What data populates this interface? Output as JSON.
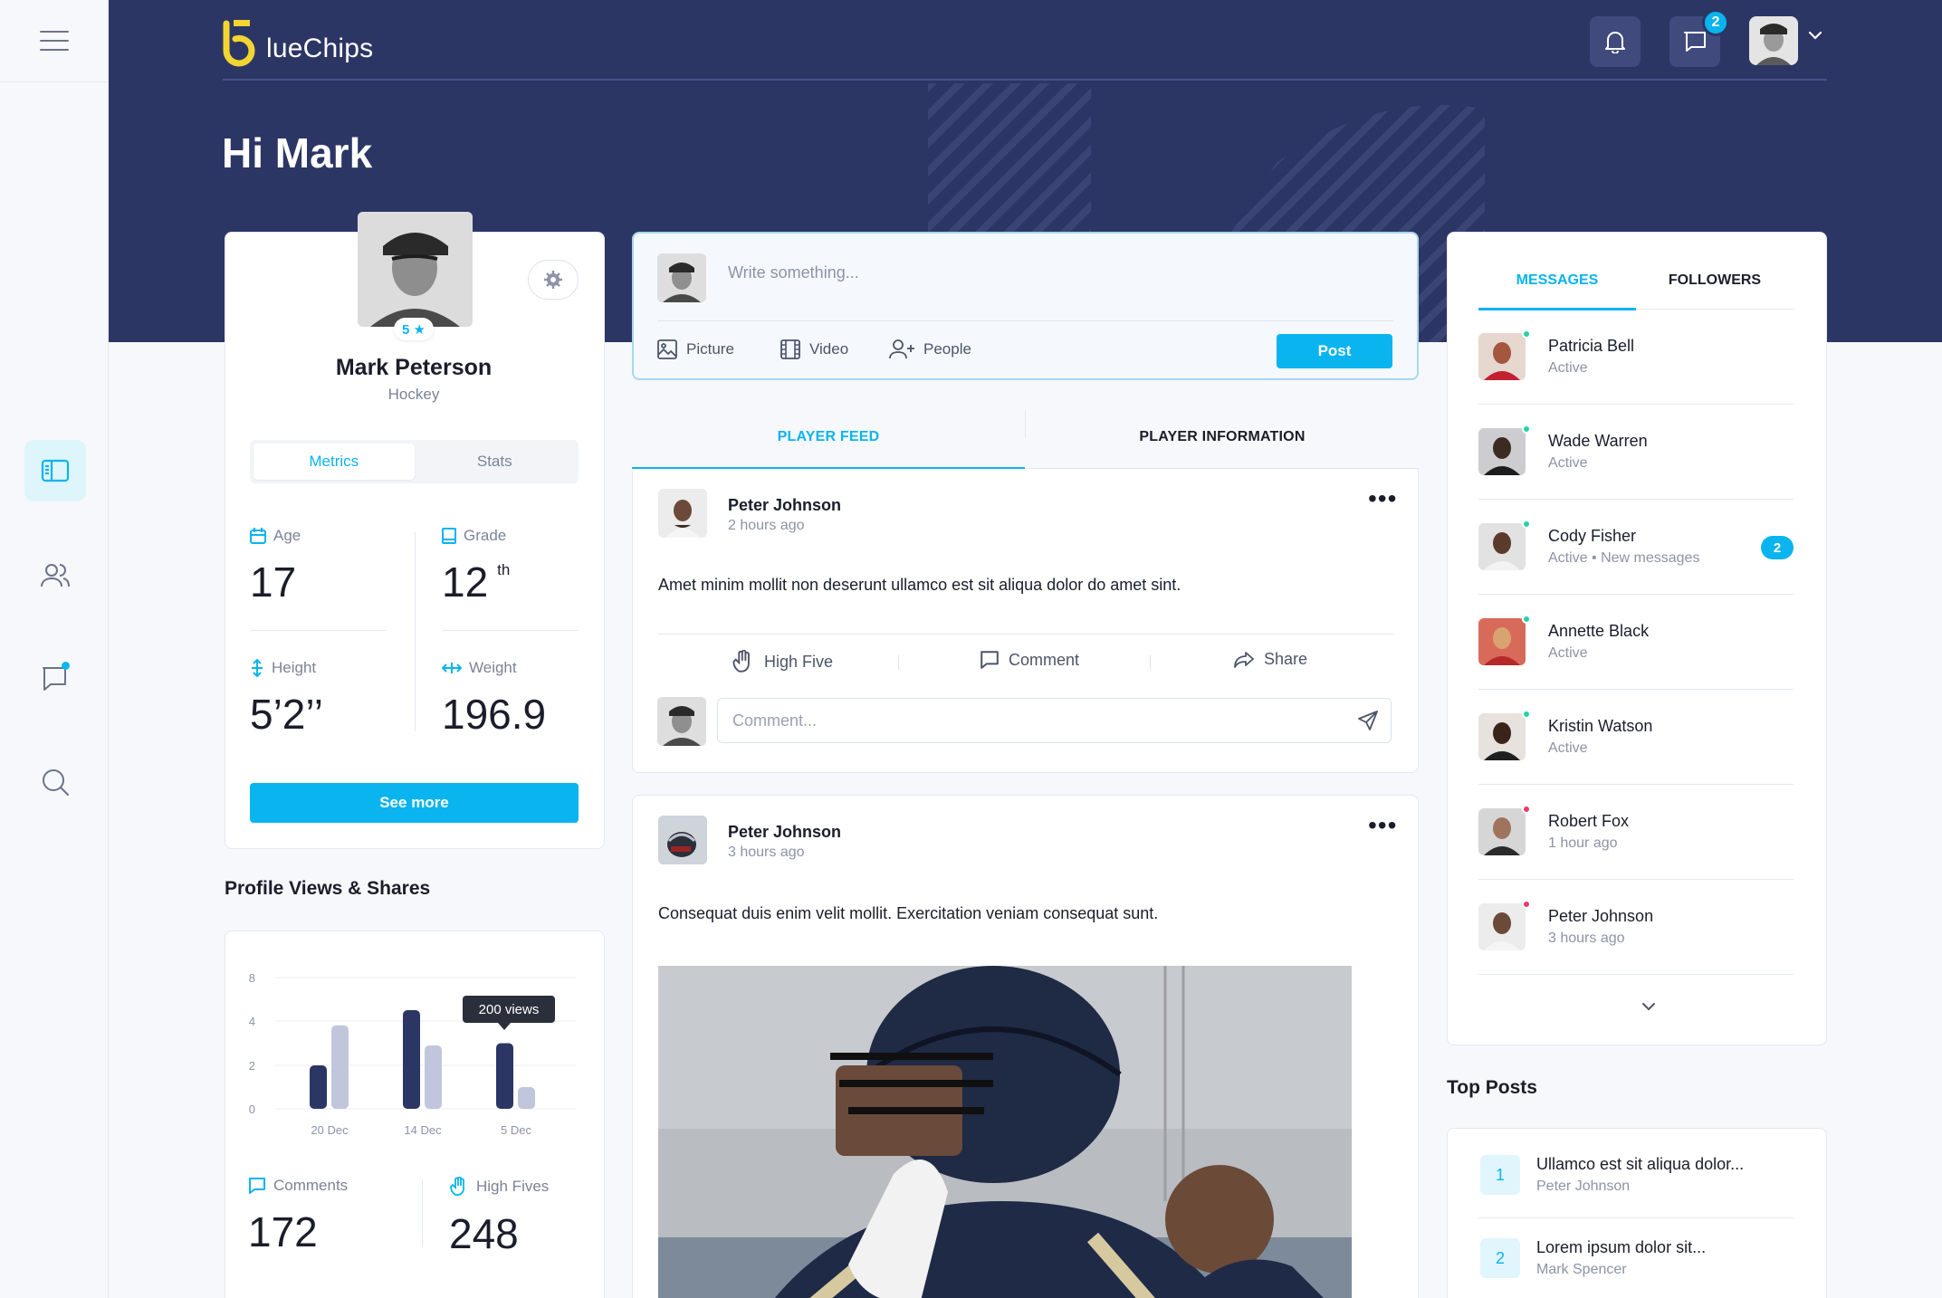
{
  "app": {
    "logo_text": "lueChips",
    "greeting": "Hi Mark"
  },
  "header": {
    "messages_badge": "2"
  },
  "profile": {
    "name": "Mark Peterson",
    "sport": "Hockey",
    "rating": "5 ★",
    "tabs": [
      "Metrics",
      "Stats"
    ],
    "metrics": [
      {
        "label": "Age",
        "value": "17",
        "suffix": ""
      },
      {
        "label": "Grade",
        "value": "12",
        "suffix": "th"
      },
      {
        "label": "Height",
        "value": "5’2’’",
        "suffix": ""
      },
      {
        "label": "Weight",
        "value": "196.9",
        "suffix": ""
      }
    ],
    "see_more": "See more"
  },
  "views_section": {
    "title": "Profile Views & Shares",
    "tooltip": "200 views",
    "comments_label": "Comments",
    "comments_value": "172",
    "highfives_label": "High Fives",
    "highfives_value": "248"
  },
  "chart_data": {
    "type": "bar",
    "title": "",
    "categories": [
      "20 Dec",
      "",
      "14 Dec",
      "",
      "5 Dec"
    ],
    "series": [
      {
        "values": [
          2,
          0,
          5,
          0,
          3
        ]
      },
      {
        "values": [
          3.8,
          0,
          2.9,
          0,
          1
        ]
      }
    ],
    "y_ticks": [
      "0",
      "2",
      "4",
      "8"
    ],
    "grid": true,
    "colors": [
      "#2c3665",
      "#c2c6dc"
    ]
  },
  "composer": {
    "placeholder": "Write something...",
    "picture": "Picture",
    "video": "Video",
    "people": "People",
    "post_button": "Post"
  },
  "feed_tabs": [
    "PLAYER FEED",
    "PLAYER INFORMATION"
  ],
  "posts": [
    {
      "author": "Peter Johnson",
      "time": "2 hours ago",
      "text": "Amet minim mollit non deserunt ullamco est sit aliqua dolor do amet sint.",
      "actions": [
        "High Five",
        "Comment",
        "Share"
      ],
      "comment_placeholder": "Comment..."
    },
    {
      "author": "Peter Johnson",
      "time": "3 hours ago",
      "text": "Consequat duis enim velit mollit. Exercitation veniam consequat sunt."
    }
  ],
  "right_tabs": [
    "MESSAGES",
    "FOLLOWERS"
  ],
  "contacts": [
    {
      "name": "Patricia Bell",
      "status": "Active",
      "dot": "#22d3a6",
      "badge": ""
    },
    {
      "name": "Wade Warren",
      "status": "Active",
      "dot": "#22d3a6",
      "badge": ""
    },
    {
      "name": "Cody Fisher",
      "status": "Active  •  New messages",
      "dot": "#22d3a6",
      "badge": "2"
    },
    {
      "name": "Annette Black",
      "status": "Active",
      "dot": "#22d3a6",
      "badge": ""
    },
    {
      "name": "Kristin Watson",
      "status": "Active",
      "dot": "#22d3a6",
      "badge": ""
    },
    {
      "name": "Robert Fox",
      "status": "1 hour ago",
      "dot": "#f0386b",
      "badge": ""
    },
    {
      "name": "Peter Johnson",
      "status": "3 hours ago",
      "dot": "#f0386b",
      "badge": ""
    }
  ],
  "top_posts": {
    "title": "Top Posts",
    "items": [
      {
        "rank": "1",
        "title": "Ullamco est sit aliqua dolor...",
        "author": "Peter Johnson"
      },
      {
        "rank": "2",
        "title": "Lorem ipsum dolor sit...",
        "author": "Mark Spencer"
      }
    ]
  }
}
